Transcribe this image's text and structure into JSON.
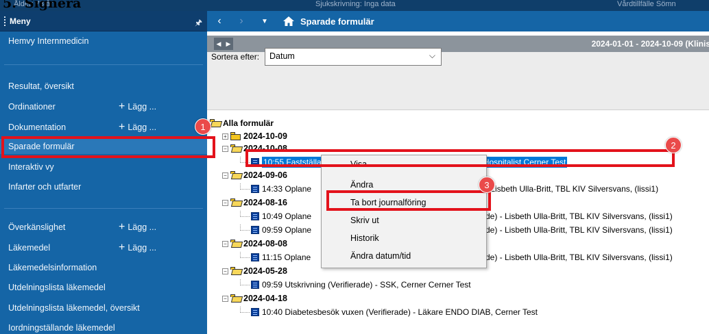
{
  "page_heading": {
    "number": "5.",
    "title": "Signera"
  },
  "top_strip": {
    "left_text": "Ålder: 78 år",
    "center_text": "Sjukskrivning: Inga data",
    "right_text": "Vårdtillfälle Sömn"
  },
  "sidebar": {
    "title": "Meny",
    "items": [
      {
        "label": "Hemvy Internmedicin"
      },
      {
        "label": "Resultat, översikt"
      },
      {
        "label": "Ordinationer",
        "add": "Lägg ..."
      },
      {
        "label": "Dokumentation",
        "add": "Lägg ..."
      },
      {
        "label": "Sparade formulär"
      },
      {
        "label": "Interaktiv vy"
      },
      {
        "label": "Infarter och utfarter"
      },
      {
        "label": "Överkänslighet",
        "add": "Lägg ..."
      },
      {
        "label": "Läkemedel",
        "add": "Lägg ..."
      },
      {
        "label": "Läkemedelsinformation"
      },
      {
        "label": "Utdelningslista läkemedel"
      },
      {
        "label": "Utdelningslista läkemedel, översikt"
      },
      {
        "label": "Iordningställande läkemedel"
      }
    ]
  },
  "main": {
    "title": "Sparade formulär",
    "date_range": "2024-01-01 - 2024-10-09 (Klinis",
    "sort_label": "Sortera efter:",
    "sort_value": "Datum",
    "tree": {
      "root": "Alla formulär",
      "dates": [
        "2024-10-09",
        "2024-10-08",
        "2024-09-06",
        "2024-08-16",
        "2024-08-08",
        "2024-05-28",
        "2024-04-18"
      ],
      "entries": [
        {
          "time": "10:55",
          "text": "Fastställande av dödsorsak (Verifierade) - Physician - Hospitalist Cerner Test"
        },
        {
          "time": "14:33",
          "text": "Oplane",
          "tail": "- Lisbeth Ulla-Britt, TBL KIV Silversvans, (lissi1)"
        },
        {
          "time": "10:49",
          "text": "Oplane",
          "tail": "de) - Lisbeth Ulla-Britt, TBL KIV Silversvans, (lissi1)"
        },
        {
          "time": "09:59",
          "text": "Oplane",
          "tail": "de) - Lisbeth Ulla-Britt, TBL KIV Silversvans, (lissi1)"
        },
        {
          "time": "11:15",
          "text": "Oplane",
          "tail": "de) - Lisbeth Ulla-Britt, TBL KIV Silversvans, (lissi1)"
        },
        {
          "time": "09:59",
          "text": "Utskrivning (Verifierade) - SSK, Cerner Cerner Test"
        },
        {
          "time": "10:40",
          "text": "Diabetesbesök vuxen (Verifierade) - Läkare ENDO DIAB, Cerner Test"
        }
      ]
    }
  },
  "context_menu": {
    "items": [
      "Visa",
      "Ändra",
      "Ta bort journalföring",
      "Skriv ut",
      "Historik",
      "Ändra datum/tid"
    ]
  },
  "markers": [
    "1",
    "2",
    "3"
  ],
  "colors": {
    "accent_red": "#e3121b",
    "sidebar_blue": "#1565a6",
    "selection_blue": "#0078d7"
  }
}
